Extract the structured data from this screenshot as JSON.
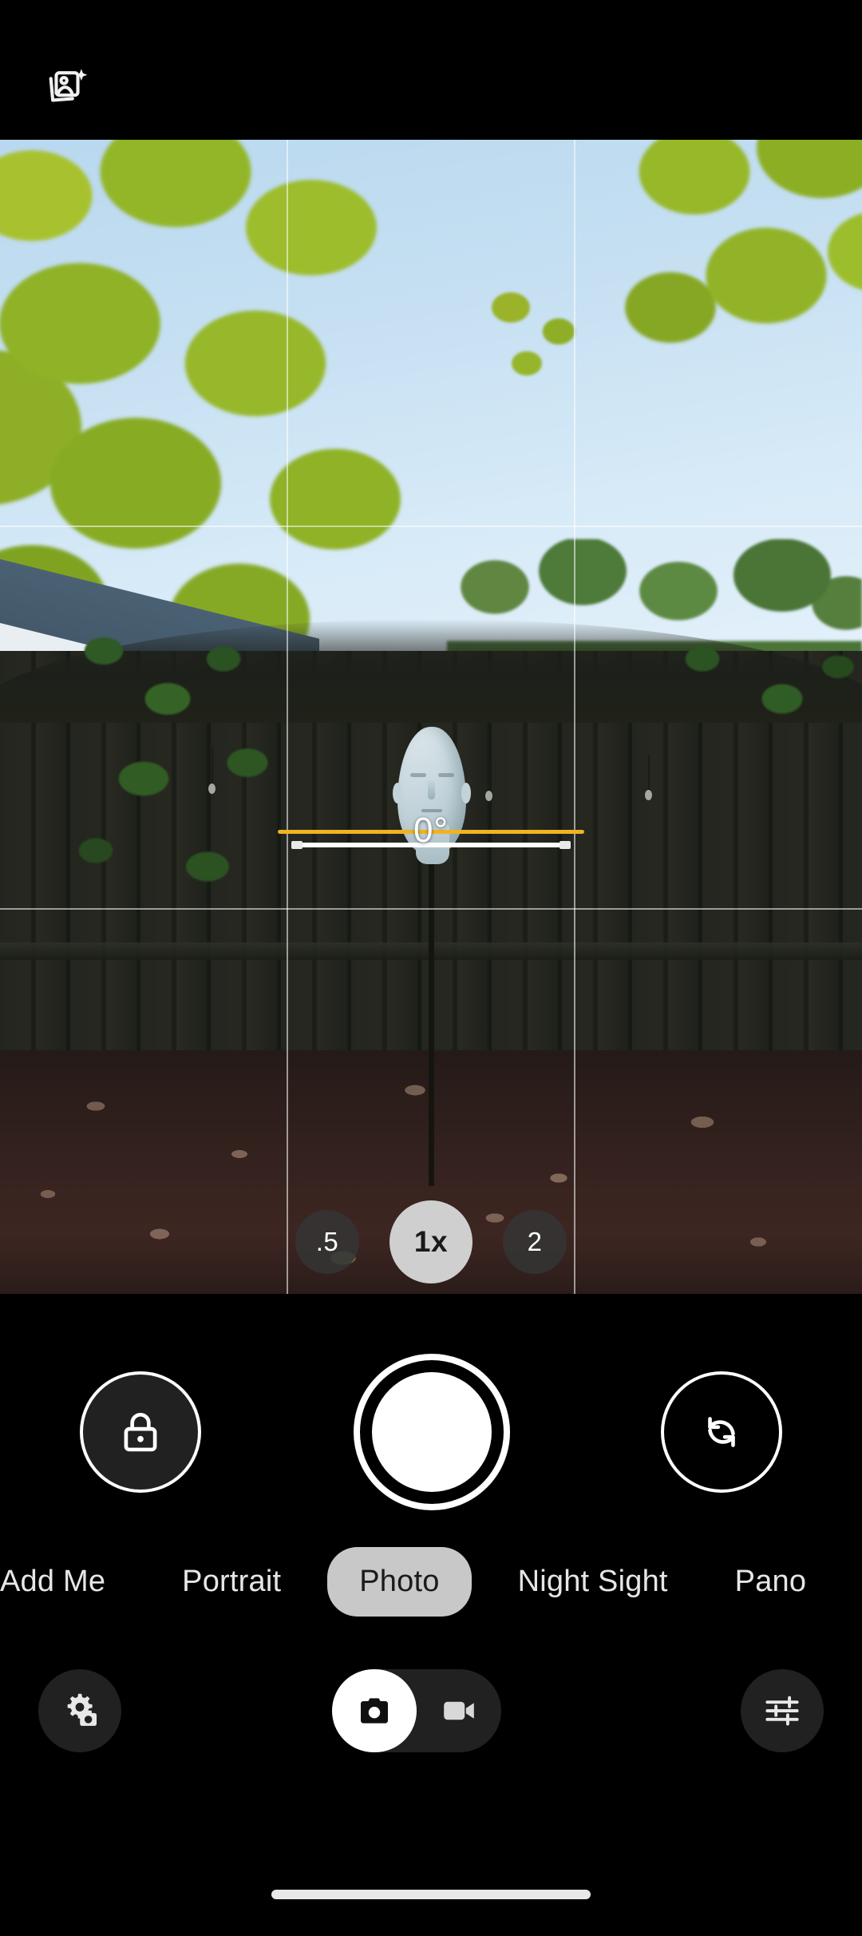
{
  "app": {
    "name": "Camera",
    "mode_active": "Photo"
  },
  "topbar": {
    "gallery_icon": "photo-stack-sparkle-icon",
    "gallery_label": "Top Shot"
  },
  "viewfinder": {
    "grid": "3x3",
    "grid_enabled": true,
    "scene_description": "Backyard with mannequin head on a stand in front of a dark wooden fence, green trees and blue sky above",
    "level": {
      "angle_text": "0°",
      "angle_value": 0,
      "level_color": "#f0b323",
      "reference_color": "#ffffff",
      "is_level": true
    }
  },
  "zoom": {
    "options": [
      {
        "label": ".5",
        "value": 0.5,
        "selected": false
      },
      {
        "label": "1x",
        "value": 1.0,
        "selected": true
      },
      {
        "label": "2",
        "value": 2.0,
        "selected": false
      }
    ],
    "selected_label": "1x",
    "pill_bg": "#343434",
    "pill_selected_bg": "#cfcfcf"
  },
  "controls": {
    "lock_button": {
      "icon": "lock-closed-icon",
      "label": "Lock"
    },
    "shutter_button": {
      "label": "Shutter"
    },
    "flip_button": {
      "icon": "camera-flip-icon",
      "label": "Switch camera"
    }
  },
  "modes": {
    "items": [
      {
        "label": "Add Me",
        "selected": false
      },
      {
        "label": "Portrait",
        "selected": false
      },
      {
        "label": "Photo",
        "selected": true
      },
      {
        "label": "Night Sight",
        "selected": false
      },
      {
        "label": "Pano",
        "selected": false
      }
    ],
    "selected": "Photo"
  },
  "toolbar": {
    "settings_button": {
      "icon": "gear-camera-icon",
      "label": "Camera settings"
    },
    "camera_toggle": {
      "icon": "camera-icon",
      "label": "Camera",
      "selected": true
    },
    "video_toggle": {
      "icon": "video-camera-icon",
      "label": "Video",
      "selected": false
    },
    "tune_button": {
      "icon": "tune-sliders-icon",
      "label": "Adjust"
    }
  },
  "navbar": {
    "gesture_pill": "home-gesture-bar"
  }
}
